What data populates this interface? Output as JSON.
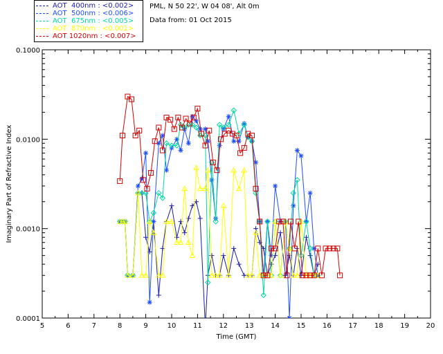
{
  "info": {
    "station": "PML, N 50 22', W 04 08', Alt 0m",
    "date_line": "Data from: 01 Oct 2015"
  },
  "chart_data": {
    "type": "line",
    "title": "",
    "xlabel": "Time (GMT)",
    "ylabel": "Imaginary Part of Refractive Index",
    "xlim": [
      5,
      20
    ],
    "ylim": [
      0.0001,
      0.1
    ],
    "yscale": "log",
    "x_ticks": [
      "5",
      "6",
      "7",
      "8",
      "9",
      "10",
      "11",
      "12",
      "13",
      "14",
      "15",
      "16",
      "17",
      "18",
      "19",
      "20"
    ],
    "y_ticks": [
      "0.0001",
      "0.0010",
      "0.0100",
      "0.1000"
    ],
    "legend_position": "top-left, outside plot",
    "series": [
      {
        "name": "AOT  400nm : <0.002>",
        "color": "#1a1aa8",
        "marker": "plus",
        "x": [
          8.0,
          8.1,
          8.2,
          8.3,
          8.5,
          8.7,
          8.85,
          9.0,
          9.15,
          9.3,
          9.5,
          9.65,
          9.8,
          10.0,
          10.2,
          10.35,
          10.5,
          10.65,
          10.8,
          10.95,
          11.1,
          11.3,
          11.4,
          11.55,
          11.7,
          11.85,
          12.0,
          12.2,
          12.4,
          12.6,
          12.8,
          12.95,
          13.1,
          13.25,
          13.4,
          13.55,
          13.7,
          13.85,
          14.0,
          14.2,
          14.4,
          14.55,
          14.7,
          14.85,
          15.0,
          15.2,
          15.35,
          15.5,
          15.65
        ],
        "values": [
          0.0012,
          0.0012,
          0.0012,
          0.0003,
          0.0003,
          0.0025,
          0.0025,
          0.0008,
          0.00055,
          0.0012,
          0.00018,
          0.0006,
          0.0012,
          0.0018,
          0.0008,
          0.0012,
          0.0009,
          0.0013,
          0.0018,
          0.002,
          0.0013,
          8e-05,
          0.0003,
          0.0005,
          0.0003,
          0.0003,
          0.0005,
          0.0003,
          0.0006,
          0.0004,
          0.0003,
          0.0003,
          0.0003,
          0.001,
          0.0007,
          0.0006,
          0.0003,
          0.0004,
          0.0005,
          0.0009,
          0.0003,
          0.0005,
          0.0003,
          0.0006,
          0.0003,
          0.0008,
          0.0005,
          0.0003,
          0.0004
        ]
      },
      {
        "name": "AOT  500nm : <0.006>",
        "color": "#1c4dff",
        "marker": "asterisk",
        "x": [
          8.0,
          8.1,
          8.2,
          8.3,
          8.5,
          8.7,
          8.85,
          9.0,
          9.15,
          9.3,
          9.5,
          9.65,
          9.8,
          10.0,
          10.2,
          10.35,
          10.5,
          10.65,
          10.8,
          10.95,
          11.1,
          11.3,
          11.4,
          11.55,
          11.7,
          11.85,
          12.0,
          12.2,
          12.4,
          12.6,
          12.8,
          12.95,
          13.1,
          13.25,
          13.4,
          13.55,
          13.7,
          13.85,
          14.0,
          14.2,
          14.4,
          14.55,
          14.7,
          14.85,
          15.0,
          15.2,
          15.35,
          15.5,
          15.65
        ],
        "values": [
          0.0012,
          0.0012,
          0.0012,
          0.0003,
          0.0003,
          0.003,
          0.0036,
          0.007,
          0.00015,
          0.0012,
          0.009,
          0.011,
          0.0045,
          0.008,
          0.01,
          0.0075,
          0.013,
          0.009,
          0.018,
          0.016,
          0.013,
          0.013,
          0.0095,
          0.0035,
          0.0013,
          0.0085,
          0.013,
          0.018,
          0.0095,
          0.0095,
          0.015,
          0.0105,
          0.0095,
          0.0055,
          0.0012,
          0.0003,
          0.0012,
          0.0005,
          0.003,
          0.0012,
          0.0012,
          0.0001,
          0.0018,
          0.0075,
          0.0065,
          0.0012,
          0.0025,
          0.0006,
          0.0003
        ]
      },
      {
        "name": "AOT  675nm : <0.005>",
        "color": "#00d8a0",
        "marker": "diamond",
        "x": [
          8.0,
          8.1,
          8.2,
          8.3,
          8.5,
          8.7,
          8.85,
          9.0,
          9.15,
          9.3,
          9.5,
          9.65,
          9.8,
          10.0,
          10.2,
          10.35,
          10.5,
          10.65,
          10.8,
          10.95,
          11.1,
          11.3,
          11.4,
          11.55,
          11.7,
          11.85,
          12.0,
          12.2,
          12.4,
          12.6,
          12.8,
          12.95,
          13.1,
          13.25,
          13.4,
          13.55,
          13.7,
          13.85,
          14.0,
          14.2,
          14.4,
          14.55,
          14.7,
          14.85,
          15.0,
          15.2,
          15.35,
          15.5,
          15.65
        ],
        "values": [
          0.0012,
          0.0012,
          0.0012,
          0.0003,
          0.0003,
          0.0025,
          0.0025,
          0.0025,
          0.0012,
          0.0015,
          0.0025,
          0.0022,
          0.009,
          0.0085,
          0.0085,
          0.0145,
          0.0135,
          0.0145,
          0.0145,
          0.0135,
          0.011,
          0.011,
          0.00025,
          0.0055,
          0.0012,
          0.0145,
          0.0135,
          0.0145,
          0.021,
          0.0115,
          0.0145,
          0.0105,
          0.0095,
          0.0025,
          0.0012,
          0.00018,
          0.0012,
          0.0003,
          0.0012,
          0.0003,
          0.0012,
          0.0006,
          0.0025,
          0.0035,
          0.0005,
          0.0012,
          0.0006,
          0.0003,
          0.0003
        ]
      },
      {
        "name": "AOT  870nm : <0.001>",
        "color": "#ffff00",
        "marker": "triangle",
        "x": [
          8.0,
          8.1,
          8.2,
          8.3,
          8.5,
          8.7,
          8.85,
          9.0,
          9.15,
          9.3,
          9.5,
          9.65,
          9.8,
          10.0,
          10.2,
          10.35,
          10.5,
          10.65,
          10.8,
          10.95,
          11.1,
          11.3,
          11.4,
          11.55,
          11.7,
          11.85,
          12.0,
          12.2,
          12.4,
          12.6,
          12.8,
          12.95,
          13.1,
          13.25,
          13.4,
          13.55,
          13.7,
          13.85,
          14.0,
          14.2,
          14.4,
          14.55,
          14.7,
          14.85,
          15.0,
          15.2,
          15.35,
          15.5,
          15.65
        ],
        "values": [
          0.0012,
          0.0012,
          0.0012,
          0.0003,
          0.0003,
          0.0025,
          0.0003,
          0.0003,
          0.0012,
          0.0009,
          0.0003,
          0.0003,
          0.0012,
          0.0012,
          0.0007,
          0.0007,
          0.0028,
          0.0007,
          0.0005,
          0.0048,
          0.0028,
          0.0028,
          0.0045,
          0.0003,
          0.0003,
          0.0003,
          0.0018,
          0.0003,
          0.0045,
          0.0028,
          0.0045,
          0.0003,
          0.0003,
          0.0009,
          0.0003,
          0.0003,
          0.0003,
          0.0003,
          0.0012,
          0.0003,
          0.0012,
          0.0006,
          0.0003,
          0.0003,
          0.0012,
          0.0003,
          0.0003,
          0.0003,
          0.0003
        ]
      },
      {
        "name": "AOT 1020nm : <0.007>",
        "color": "#d00000",
        "marker": "square",
        "x": [
          8.0,
          8.1,
          8.3,
          8.45,
          8.6,
          8.75,
          8.9,
          9.05,
          9.2,
          9.35,
          9.5,
          9.65,
          9.8,
          9.95,
          10.1,
          10.25,
          10.4,
          10.55,
          10.7,
          10.85,
          11.0,
          11.15,
          11.3,
          11.45,
          11.6,
          11.75,
          11.9,
          12.05,
          12.2,
          12.35,
          12.5,
          12.65,
          12.8,
          12.95,
          13.1,
          13.25,
          13.4,
          13.55,
          13.7,
          13.85,
          14.0,
          14.15,
          14.3,
          14.45,
          14.6,
          14.75,
          14.9,
          15.05,
          15.2,
          15.35,
          15.5,
          15.65,
          15.8,
          15.95,
          16.1,
          16.25,
          16.4,
          16.5
        ],
        "values": [
          0.0034,
          0.011,
          0.03,
          0.028,
          0.011,
          0.0125,
          0.0035,
          0.0028,
          0.0042,
          0.0095,
          0.0135,
          0.0075,
          0.0175,
          0.0165,
          0.013,
          0.0175,
          0.0135,
          0.017,
          0.015,
          0.0175,
          0.022,
          0.0115,
          0.0085,
          0.0125,
          0.0055,
          0.0045,
          0.01,
          0.0115,
          0.0125,
          0.0115,
          0.011,
          0.007,
          0.008,
          0.0115,
          0.011,
          0.0028,
          0.0012,
          0.0003,
          0.0003,
          0.0006,
          0.0006,
          0.0012,
          0.0012,
          0.0003,
          0.0012,
          0.0006,
          0.0012,
          0.0003,
          0.0003,
          0.0003,
          0.0003,
          0.0006,
          0.0003,
          0.0006,
          0.0006,
          0.0006,
          0.0006,
          0.0003
        ]
      }
    ]
  }
}
